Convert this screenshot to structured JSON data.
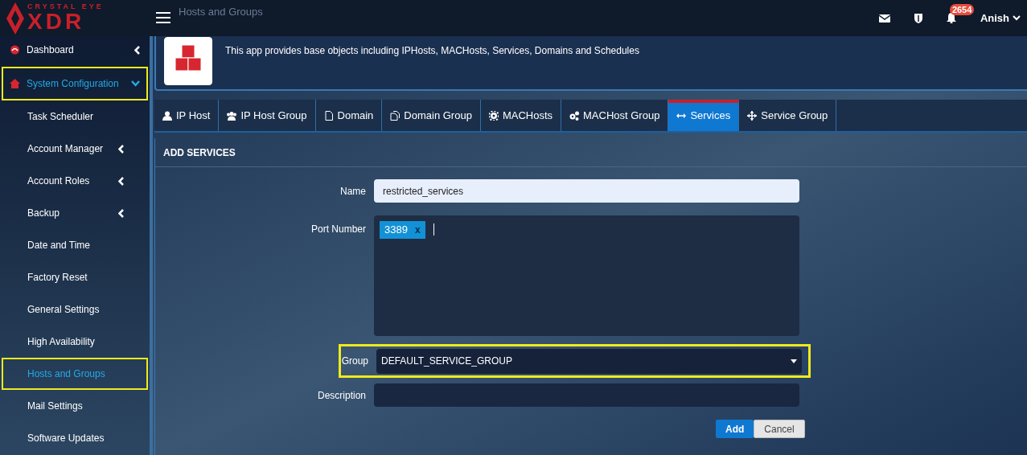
{
  "logo": {
    "top": "CRYSTAL EYE",
    "bottom": "XDR"
  },
  "header": {
    "page_title": "Hosts and Groups",
    "notification_count": "2654",
    "user": "Anish"
  },
  "sidebar": {
    "items": [
      {
        "label": "Dashboard",
        "kind": "top",
        "expanded": false,
        "selected": false,
        "highlighted": false
      },
      {
        "label": "System Configuration",
        "kind": "top",
        "expanded": true,
        "selected": true,
        "highlighted": true
      },
      {
        "label": "Task Scheduler",
        "kind": "sub",
        "has_children": false,
        "selected": false,
        "highlighted": false
      },
      {
        "label": "Account Manager",
        "kind": "sub",
        "has_children": true,
        "selected": false,
        "highlighted": false
      },
      {
        "label": "Account Roles",
        "kind": "sub",
        "has_children": true,
        "selected": false,
        "highlighted": false
      },
      {
        "label": "Backup",
        "kind": "sub",
        "has_children": true,
        "selected": false,
        "highlighted": false
      },
      {
        "label": "Date and Time",
        "kind": "sub",
        "has_children": false,
        "selected": false,
        "highlighted": false
      },
      {
        "label": "Factory Reset",
        "kind": "sub",
        "has_children": false,
        "selected": false,
        "highlighted": false
      },
      {
        "label": "General Settings",
        "kind": "sub",
        "has_children": false,
        "selected": false,
        "highlighted": false
      },
      {
        "label": "High Availability",
        "kind": "sub",
        "has_children": false,
        "selected": false,
        "highlighted": false
      },
      {
        "label": "Hosts and Groups",
        "kind": "sub",
        "has_children": false,
        "selected": true,
        "highlighted": true
      },
      {
        "label": "Mail Settings",
        "kind": "sub",
        "has_children": false,
        "selected": false,
        "highlighted": false
      },
      {
        "label": "Software Updates",
        "kind": "sub",
        "has_children": false,
        "selected": false,
        "highlighted": false
      }
    ]
  },
  "app_info": {
    "description": "This app provides base objects including IPHosts, MACHosts, Services, Domains and Schedules"
  },
  "tabs": [
    {
      "label": "IP Host",
      "kind": "user",
      "selected": false
    },
    {
      "label": "IP Host Group",
      "kind": "users",
      "selected": false
    },
    {
      "label": "Domain",
      "kind": "file",
      "selected": false
    },
    {
      "label": "Domain Group",
      "kind": "files",
      "selected": false
    },
    {
      "label": "MACHosts",
      "kind": "gear",
      "selected": false
    },
    {
      "label": "MACHost Group",
      "kind": "gears",
      "selected": false
    },
    {
      "label": "Services",
      "kind": "arrows",
      "selected": true
    },
    {
      "label": "Service Group",
      "kind": "move",
      "selected": false
    }
  ],
  "form": {
    "title": "ADD SERVICES",
    "name": {
      "label": "Name",
      "value": "restricted_services"
    },
    "port_number": {
      "label": "Port Number",
      "tags": [
        {
          "text": "3389",
          "remove": "x"
        }
      ]
    },
    "group": {
      "label": "Group",
      "value": "DEFAULT_SERVICE_GROUP",
      "highlighted": true
    },
    "description": {
      "label": "Description"
    },
    "buttons": [
      {
        "label": "Add",
        "kind": "primary"
      },
      {
        "label": "Cancel",
        "kind": "secondary"
      }
    ]
  }
}
